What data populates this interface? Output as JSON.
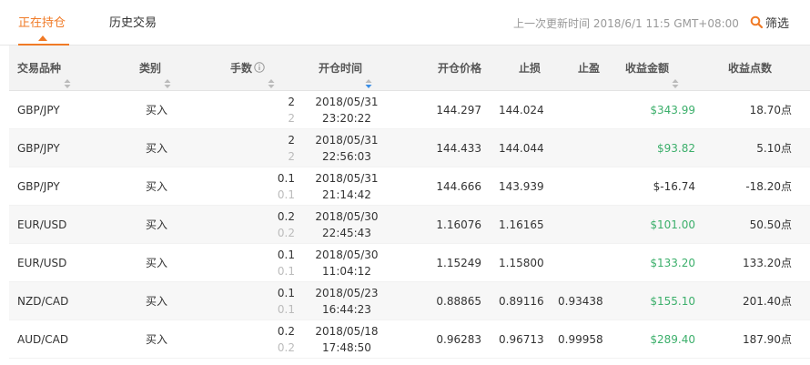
{
  "tabs": [
    {
      "label": "正在持仓",
      "active": true
    },
    {
      "label": "历史交易",
      "active": false
    }
  ],
  "last_update": "上一次更新时间 2018/6/1 11:5 GMT+08:00",
  "filter_label": "筛选",
  "colors": {
    "accent": "#f07a26",
    "profit": "#3caf6b"
  },
  "columns": {
    "symbol": "交易品种",
    "type": "类别",
    "lots": "手数",
    "open_time": "开仓时间",
    "open_price": "开仓价格",
    "stop_loss": "止损",
    "take_profit": "止盈",
    "profit_amount": "收益金额",
    "profit_points": "收益点数"
  },
  "rows": [
    {
      "symbol": "GBP/JPY",
      "type": "买入",
      "lots": "2",
      "lots_sub": "2",
      "date": "2018/05/31",
      "time": "23:20:22",
      "open_price": "144.297",
      "stop_loss": "144.024",
      "take_profit": "",
      "profit_amount": "$343.99",
      "profit_positive": true,
      "profit_points": "18.70点"
    },
    {
      "symbol": "GBP/JPY",
      "type": "买入",
      "lots": "2",
      "lots_sub": "2",
      "date": "2018/05/31",
      "time": "22:56:03",
      "open_price": "144.433",
      "stop_loss": "144.044",
      "take_profit": "",
      "profit_amount": "$93.82",
      "profit_positive": true,
      "profit_points": "5.10点"
    },
    {
      "symbol": "GBP/JPY",
      "type": "买入",
      "lots": "0.1",
      "lots_sub": "0.1",
      "date": "2018/05/31",
      "time": "21:14:42",
      "open_price": "144.666",
      "stop_loss": "143.939",
      "take_profit": "",
      "profit_amount": "$-16.74",
      "profit_positive": false,
      "profit_points": "-18.20点"
    },
    {
      "symbol": "EUR/USD",
      "type": "买入",
      "lots": "0.2",
      "lots_sub": "0.2",
      "date": "2018/05/30",
      "time": "22:45:43",
      "open_price": "1.16076",
      "stop_loss": "1.16165",
      "take_profit": "",
      "profit_amount": "$101.00",
      "profit_positive": true,
      "profit_points": "50.50点"
    },
    {
      "symbol": "EUR/USD",
      "type": "买入",
      "lots": "0.1",
      "lots_sub": "0.1",
      "date": "2018/05/30",
      "time": "11:04:12",
      "open_price": "1.15249",
      "stop_loss": "1.15800",
      "take_profit": "",
      "profit_amount": "$133.20",
      "profit_positive": true,
      "profit_points": "133.20点"
    },
    {
      "symbol": "NZD/CAD",
      "type": "买入",
      "lots": "0.1",
      "lots_sub": "0.1",
      "date": "2018/05/23",
      "time": "16:44:23",
      "open_price": "0.88865",
      "stop_loss": "0.89116",
      "take_profit": "0.93438",
      "profit_amount": "$155.10",
      "profit_positive": true,
      "profit_points": "201.40点"
    },
    {
      "symbol": "AUD/CAD",
      "type": "买入",
      "lots": "0.2",
      "lots_sub": "0.2",
      "date": "2018/05/18",
      "time": "17:48:50",
      "open_price": "0.96283",
      "stop_loss": "0.96713",
      "take_profit": "0.99958",
      "profit_amount": "$289.40",
      "profit_positive": true,
      "profit_points": "187.90点"
    }
  ]
}
